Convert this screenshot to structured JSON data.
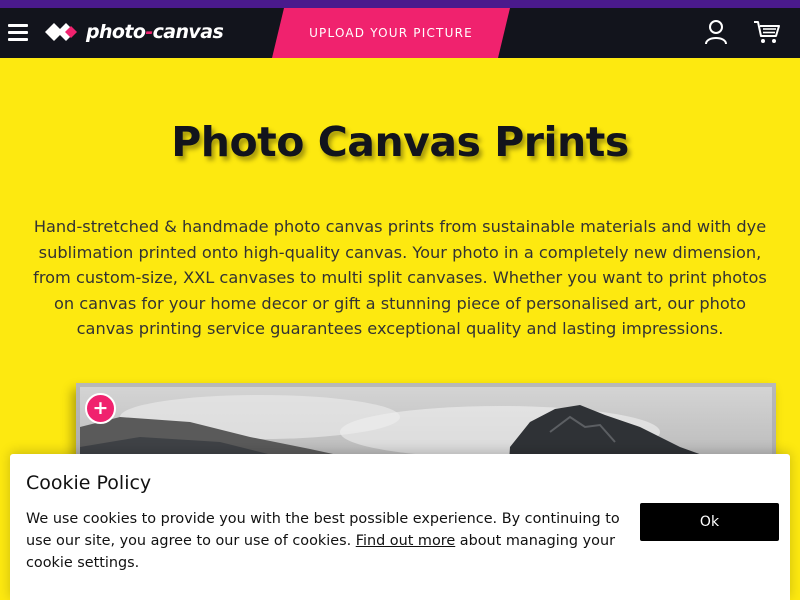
{
  "header": {
    "menu_icon": "hamburger-icon",
    "logo": {
      "part1": "photo",
      "dash": "-",
      "part2": "canvas"
    },
    "upload_label": "UPLOAD YOUR PICTURE",
    "account_icon": "user-icon",
    "cart_icon": "cart-icon"
  },
  "main": {
    "title": "Photo Canvas Prints",
    "intro": "Hand-stretched & handmade photo canvas prints from sustainable materials and with dye sublimation printed onto high-quality canvas. Your photo in a completely new dimension, from custom-size, XXL canvases to multi split canvases. Whether you want to print photos on canvas for your home decor or gift a stunning piece of personalised art, our photo canvas printing service guarantees exceptional quality and lasting impressions.",
    "plus_label": "+"
  },
  "cookie": {
    "title": "Cookie Policy",
    "text_before": "We use cookies to provide you with the best possible experience. By continuing to use our site, you agree to our use of cookies. ",
    "link_text": "Find out more",
    "text_after": " about managing your cookie settings.",
    "ok_label": "Ok"
  },
  "colors": {
    "page_background": "#fde910",
    "header_background": "#12141c",
    "accent_pink": "#f0226e",
    "top_stripe": "#4a1a8c"
  }
}
